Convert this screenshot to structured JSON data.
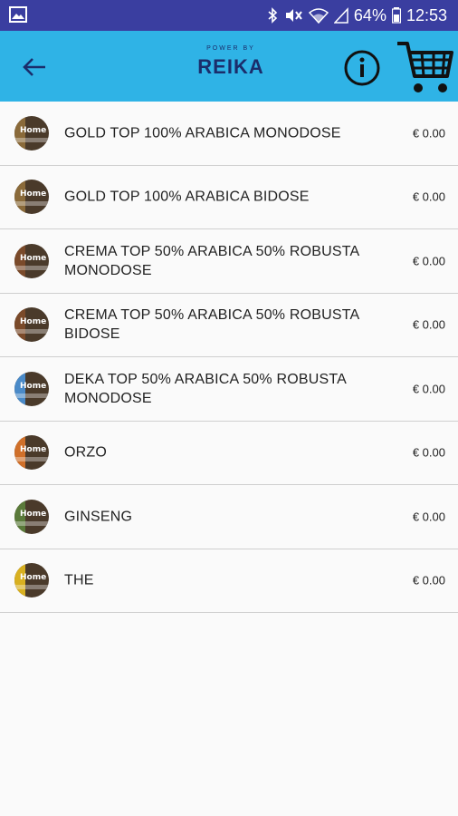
{
  "status_bar": {
    "battery": "64%",
    "time": "12:53"
  },
  "toolbar": {
    "logo_powered": "POWER BY",
    "logo_brand": "REIKA"
  },
  "products": [
    {
      "name": "GOLD TOP 100% ARABICA MONODOSE",
      "price": "€ 0.00",
      "color": "#8a6a3a"
    },
    {
      "name": "GOLD TOP 100% ARABICA BIDOSE",
      "price": "€ 0.00",
      "color": "#8a6a3a"
    },
    {
      "name": "CREMA TOP 50% ARABICA 50% ROBUSTA MONODOSE",
      "price": "€ 0.00",
      "color": "#7a4a2a"
    },
    {
      "name": "CREMA TOP 50% ARABICA 50% ROBUSTA BIDOSE",
      "price": "€ 0.00",
      "color": "#7a4a2a"
    },
    {
      "name": "DEKA TOP 50% ARABICA 50% ROBUSTA MONODOSE",
      "price": "€ 0.00",
      "color": "#4a8ac8"
    },
    {
      "name": "ORZO",
      "price": "€ 0.00",
      "color": "#d0702a"
    },
    {
      "name": "GINSENG",
      "price": "€ 0.00",
      "color": "#5a7a3a"
    },
    {
      "name": "THE",
      "price": "€ 0.00",
      "color": "#d8b020"
    }
  ],
  "thumb_label": "Home"
}
